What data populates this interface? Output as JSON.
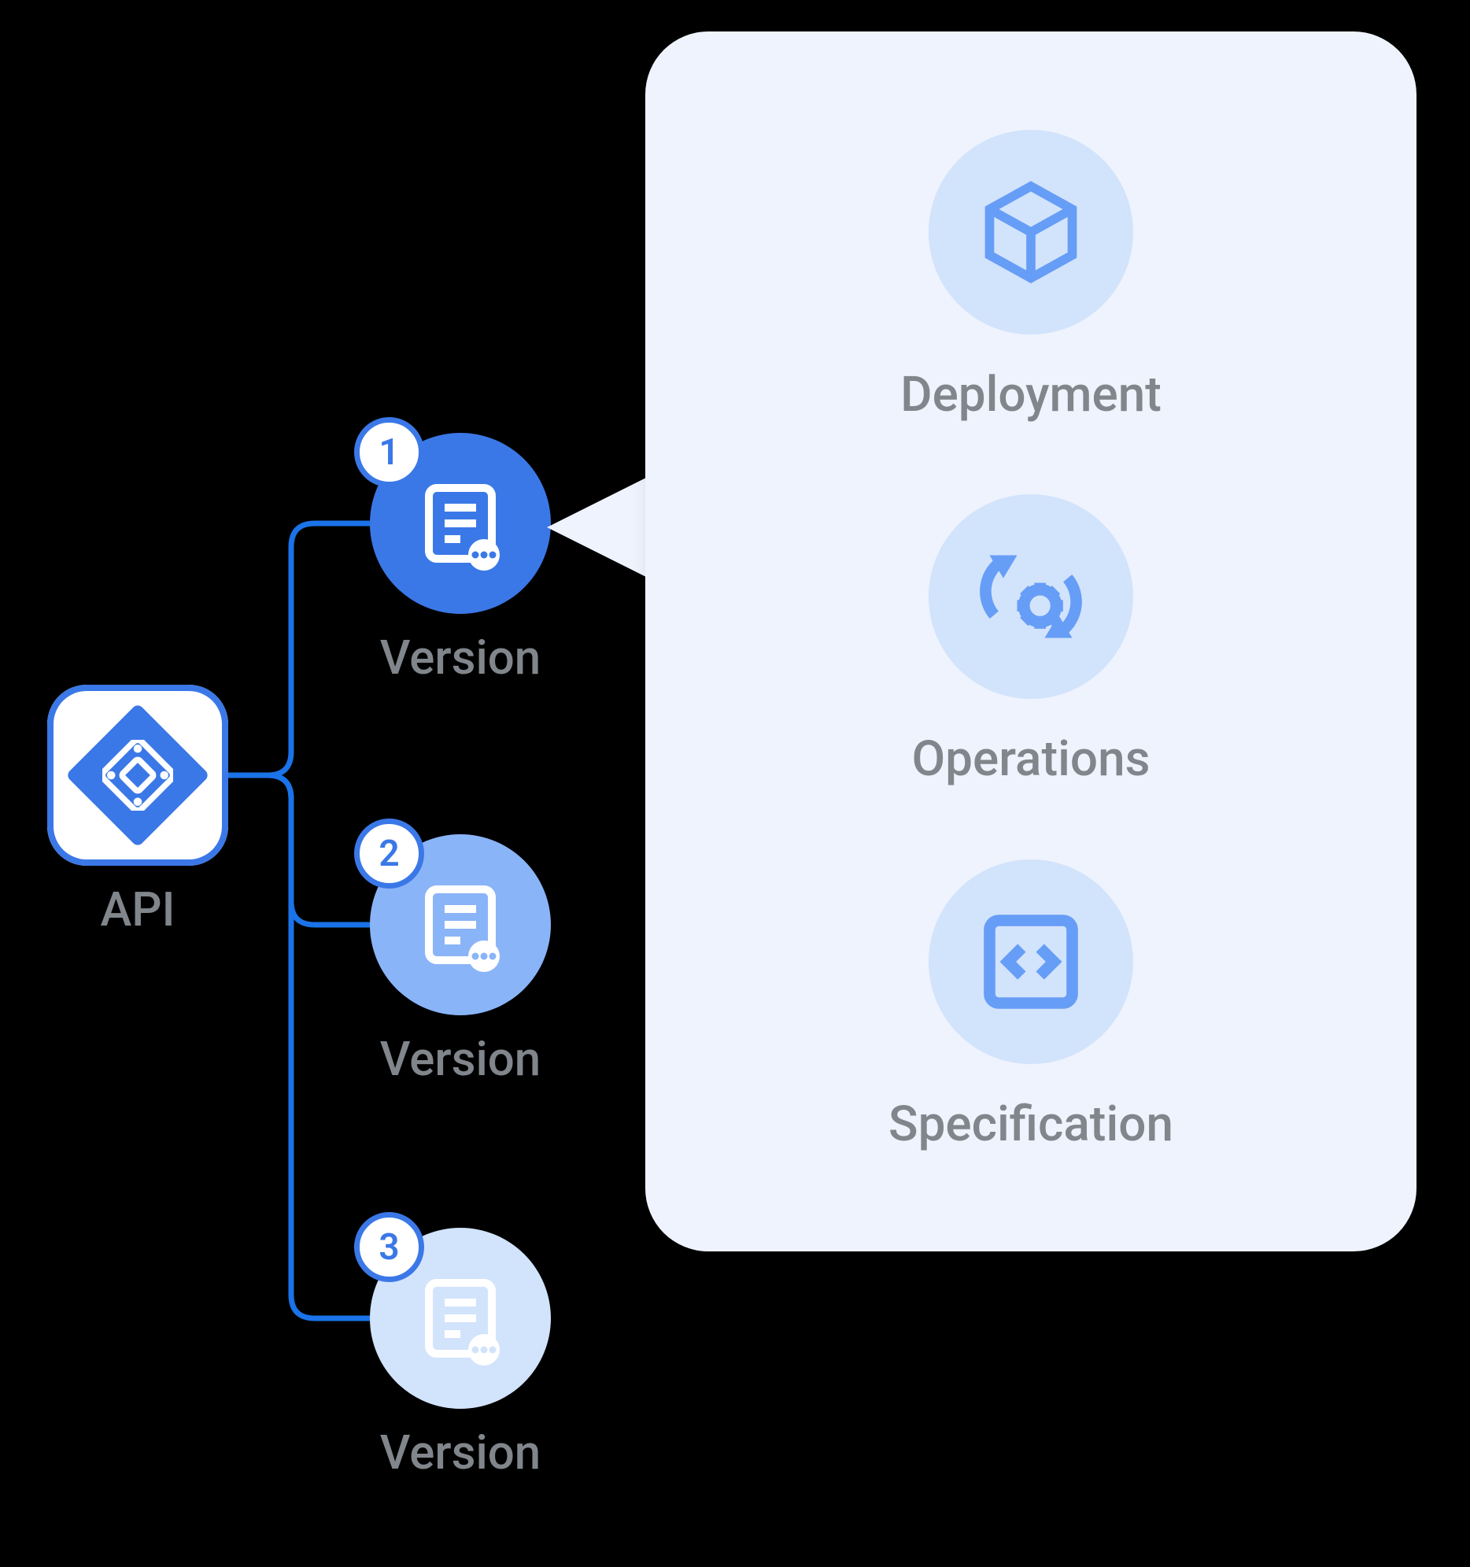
{
  "root": {
    "label": "API"
  },
  "versions": [
    {
      "badge": "1",
      "label": "Version"
    },
    {
      "badge": "2",
      "label": "Version"
    },
    {
      "badge": "3",
      "label": "Version"
    }
  ],
  "callout_from_version_index": 0,
  "panel": {
    "items": [
      {
        "icon": "cube",
        "label": "Deployment"
      },
      {
        "icon": "ops",
        "label": "Operations"
      },
      {
        "icon": "spec",
        "label": "Specification"
      }
    ]
  },
  "colors": {
    "primary": "#3b78e7",
    "light1": "#8ab4f8",
    "light2": "#d2e3fc",
    "panel_bg": "#eef3fd",
    "label": "#80868b"
  }
}
